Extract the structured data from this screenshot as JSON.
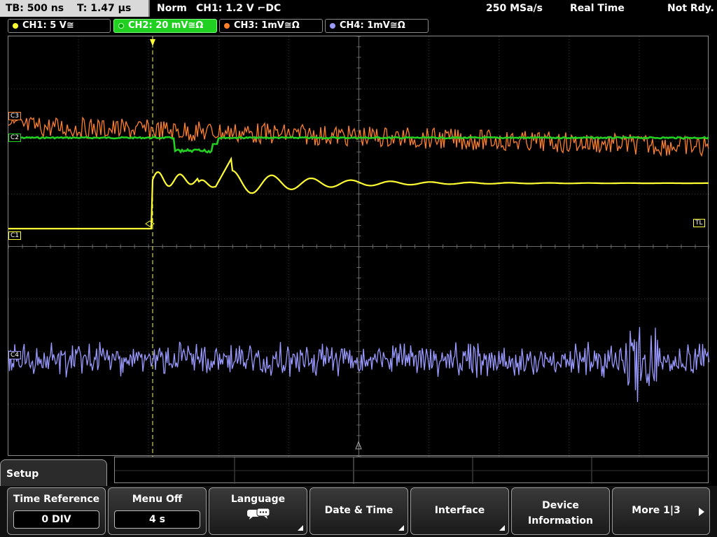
{
  "topbar": {
    "timebase": "TB: 500 ns",
    "trigger_time": "T: 1.47 µs",
    "mode": "Norm",
    "trigger_info": "CH1: 1.2 V ⌐DC",
    "sample_rate": "250 MSa/s",
    "acq_mode": "Real Time",
    "state": "Not Rdy."
  },
  "channels": [
    {
      "label": "CH1: 5 V≅",
      "color": "#ffff33",
      "active": false
    },
    {
      "label": "CH2: 20 mV≅Ω",
      "color": "#22d022",
      "active": true
    },
    {
      "label": "CH3: 1mV≅Ω",
      "color": "#ff7f2a",
      "active": false
    },
    {
      "label": "CH4: 1mV≅Ω",
      "color": "#9999ff",
      "active": false
    }
  ],
  "markers": {
    "c3": "C3",
    "c2": "C2",
    "c1": "C1",
    "c4": "C4",
    "trigger_level": "TL",
    "trigger_pos": "T"
  },
  "menu": {
    "title": "Setup",
    "keys": {
      "time_reference": {
        "label": "Time Reference",
        "value": "0 DIV"
      },
      "menu_off": {
        "label": "Menu Off",
        "value": "4 s"
      },
      "language": {
        "label": "Language"
      },
      "date_time": {
        "label": "Date & Time"
      },
      "interface": {
        "label": "Interface"
      },
      "device_info": {
        "line1": "Device",
        "line2": "Information"
      },
      "more": {
        "label": "More 1|3"
      }
    }
  },
  "colors": {
    "ch1": "#ffff33",
    "ch2": "#22d022",
    "ch3": "#ff7f2a",
    "ch4": "#9999ff",
    "grid": "#555555"
  }
}
